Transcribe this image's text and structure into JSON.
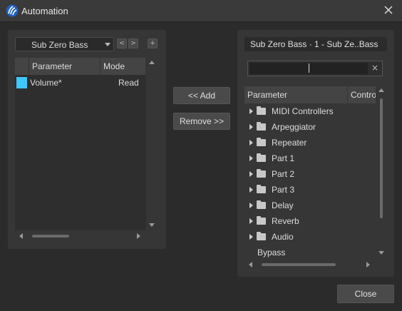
{
  "window": {
    "title": "Automation",
    "app_icon": "app-logo-icon",
    "close_icon": "close-icon"
  },
  "left": {
    "track_select": {
      "value": "Sub Zero Bass"
    },
    "prev_label": "<",
    "next_label": ">",
    "add_track_label": "+",
    "columns": [
      "Parameter",
      "Mode"
    ],
    "rows": [
      {
        "color": "#3ec8ff",
        "parameter": "Volume*",
        "mode": "Read"
      }
    ]
  },
  "middle": {
    "add_label": "<< Add",
    "remove_label": "Remove >>"
  },
  "right": {
    "track_name": "Sub Zero Bass · 1 - Sub Ze..Bass",
    "search": {
      "value": "",
      "placeholder": ""
    },
    "clear_label": "×",
    "columns": [
      "Parameter",
      "Contro"
    ],
    "tree": [
      {
        "label": "MIDI Controllers",
        "folder": true
      },
      {
        "label": "Arpeggiator",
        "folder": true
      },
      {
        "label": "Repeater",
        "folder": true
      },
      {
        "label": "Part 1",
        "folder": true
      },
      {
        "label": "Part 2",
        "folder": true
      },
      {
        "label": "Part 3",
        "folder": true
      },
      {
        "label": "Delay",
        "folder": true
      },
      {
        "label": "Reverb",
        "folder": true
      },
      {
        "label": "Audio",
        "folder": true
      },
      {
        "label": "Bypass",
        "folder": false
      }
    ]
  },
  "footer": {
    "close_label": "Close"
  },
  "colors": {
    "accent": "#3ec8ff",
    "background": "#2b2b2b",
    "panel": "#363636"
  }
}
